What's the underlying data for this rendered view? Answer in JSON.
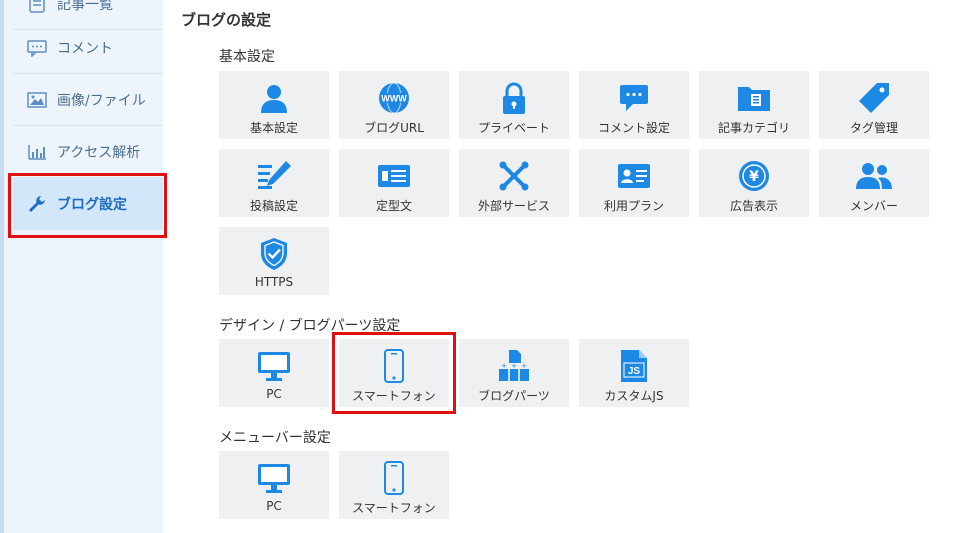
{
  "sidebar": {
    "items": [
      {
        "label": "記事一覧",
        "icon": "document-icon"
      },
      {
        "label": "コメント",
        "icon": "comment-icon"
      },
      {
        "label": "画像/ファイル",
        "icon": "image-icon"
      },
      {
        "label": "アクセス解析",
        "icon": "bar-chart-icon"
      },
      {
        "label": "ブログ設定",
        "icon": "wrench-icon",
        "active": true
      }
    ]
  },
  "main": {
    "title": "ブログの設定",
    "sections": [
      {
        "title": "基本設定",
        "tiles": [
          {
            "label": "基本設定",
            "icon": "person-icon"
          },
          {
            "label": "ブログURL",
            "icon": "www-globe-icon"
          },
          {
            "label": "プライベート",
            "icon": "lock-icon"
          },
          {
            "label": "コメント設定",
            "icon": "comment-bubble-icon"
          },
          {
            "label": "記事カテゴリ",
            "icon": "folder-icon"
          },
          {
            "label": "タグ管理",
            "icon": "tag-icon"
          },
          {
            "label": "投稿設定",
            "icon": "pencil-icon"
          },
          {
            "label": "定型文",
            "icon": "template-icon"
          },
          {
            "label": "外部サービス",
            "icon": "plugin-icon"
          },
          {
            "label": "利用プラン",
            "icon": "id-card-icon"
          },
          {
            "label": "広告表示",
            "icon": "yen-icon"
          },
          {
            "label": "メンバー",
            "icon": "members-icon"
          },
          {
            "label": "HTTPS",
            "icon": "shield-check-icon"
          }
        ]
      },
      {
        "title": "デザイン / ブログパーツ設定",
        "tiles": [
          {
            "label": "PC",
            "icon": "monitor-icon"
          },
          {
            "label": "スマートフォン",
            "icon": "smartphone-icon"
          },
          {
            "label": "ブログパーツ",
            "icon": "blog-parts-icon"
          },
          {
            "label": "カスタムJS",
            "icon": "js-file-icon"
          }
        ]
      },
      {
        "title": "メニューバー設定",
        "tiles": [
          {
            "label": "PC",
            "icon": "monitor-icon"
          },
          {
            "label": "スマートフォン",
            "icon": "smartphone-icon"
          }
        ]
      }
    ]
  },
  "colors": {
    "accent": "#1e88e5",
    "highlight": "#e01010",
    "tile_bg": "#eff0f2",
    "sidebar_bg": "#eef4fb"
  }
}
